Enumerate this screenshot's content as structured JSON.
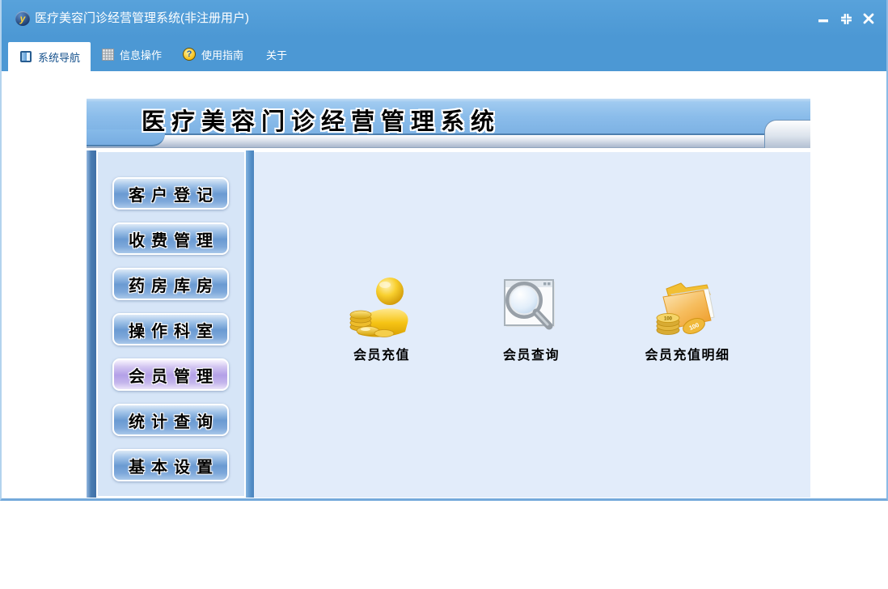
{
  "window": {
    "title": "医疗美容门诊经营管理系统(非注册用户)",
    "app_icon_letter": "y"
  },
  "tabs": [
    {
      "label": "系统导航",
      "icon": "navigation-square-icon",
      "active": true
    },
    {
      "label": "信息操作",
      "icon": "grid-icon",
      "active": false
    },
    {
      "label": "使用指南",
      "icon": "help-icon",
      "active": false,
      "help_glyph": "?"
    },
    {
      "label": "关于",
      "icon": "",
      "active": false
    }
  ],
  "banner": {
    "title": "医疗美容门诊经营管理系统"
  },
  "sidebar": {
    "items": [
      {
        "label": "客户登记",
        "selected": false
      },
      {
        "label": "收费管理",
        "selected": false
      },
      {
        "label": "药房库房",
        "selected": false
      },
      {
        "label": "操作科室",
        "selected": false
      },
      {
        "label": "会员管理",
        "selected": true
      },
      {
        "label": "统计查询",
        "selected": false
      },
      {
        "label": "基本设置",
        "selected": false
      }
    ]
  },
  "shortcuts": [
    {
      "label": "会员充值",
      "icon": "member-recharge-icon"
    },
    {
      "label": "会员查询",
      "icon": "member-search-icon"
    },
    {
      "label": "会员充值明细",
      "icon": "recharge-details-icon",
      "coin_label": "100"
    }
  ],
  "colors": {
    "titlebar_blue": "#4c98d4",
    "banner_blue": "#8abcea",
    "sidebar_bg": "#d6e5f7",
    "main_bg": "#e2ecfa",
    "button_blue": "#6a9ad2",
    "selected_purple": "#b3a0e7",
    "frame_border": "#8cbbe5"
  }
}
